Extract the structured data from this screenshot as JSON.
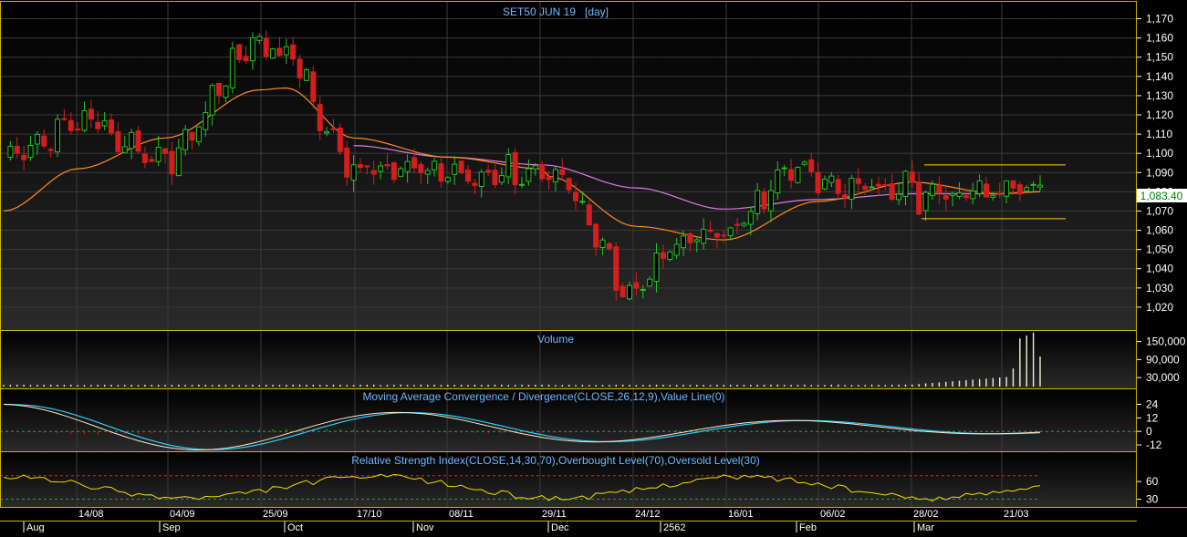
{
  "colors": {
    "background": "#000000",
    "panel_gradient_top": "#000000",
    "panel_gradient_bottom": "#2a2a2a",
    "frame": "#c8b400",
    "title": "#6fb7ff",
    "axis_text": "#ffffff",
    "grid": "#3a3a3a",
    "up_candle": "#22c422",
    "down_candle": "#d41e1e",
    "ma_fast": "#ff8a1e",
    "ma_slow": "#e07ae8",
    "range_lines": "#ffd200",
    "volume_bar": "#f4f0d8",
    "macd_line": "#ffe8c8",
    "macd_signal": "#2ad0ff",
    "macd_zero": "#3c9c3c",
    "rsi_line": "#f0e000",
    "rsi_overbought": "#c03030",
    "rsi_oversold": "#2aa02a",
    "last_price_bg": "#ffffff",
    "last_price_text": "#008000"
  },
  "price_panel": {
    "title": "SET50 JUN 19   [day]",
    "y_ticks": [
      "1,170",
      "1,160",
      "1,150",
      "1,140",
      "1,130",
      "1,120",
      "1,110",
      "1,100",
      "1,090",
      "1,080",
      "1,070",
      "1,060",
      "1,050",
      "1,040",
      "1,030",
      "1,020"
    ],
    "last_price_label": "1,083.40"
  },
  "volume_panel": {
    "title": "Volume",
    "y_ticks": [
      "150,000",
      "90,000",
      "30,000"
    ]
  },
  "macd_panel": {
    "title": "Moving Average Convergence / Divergence(CLOSE,26,12,9),Value Line(0)",
    "y_ticks": [
      "24",
      "12",
      "0",
      "-12"
    ]
  },
  "rsi_panel": {
    "title": "Relative Strength Index(CLOSE,14,30,70),Overbought Level(70),Oversold Level(30)",
    "y_ticks": [
      "60",
      "30"
    ]
  },
  "x_axis": {
    "date_labels": [
      "14/08",
      "04/09",
      "25/09",
      "17/10",
      "08/11",
      "29/11",
      "24/12",
      "16/01",
      "06/02",
      "28/02",
      "21/03"
    ],
    "period_labels": [
      "Aug",
      "Sep",
      "Oct",
      "Nov",
      "Dec",
      "2562",
      "Feb",
      "Mar"
    ]
  },
  "chart_data": [
    {
      "type": "candlestick",
      "title": "SET50 JUN 19   [day]",
      "ylim": [
        1010,
        1175
      ],
      "x": [
        "14/08",
        "04/09",
        "25/09",
        "17/10",
        "08/11",
        "29/11",
        "24/12",
        "16/01",
        "06/02",
        "28/02",
        "21/03"
      ],
      "close_anchors": [
        {
          "x": "start",
          "y": 1095
        },
        {
          "x": "14/08",
          "y": 1115
        },
        {
          "x": "Sep",
          "y": 1098
        },
        {
          "x": "25/09",
          "y": 1158
        },
        {
          "x": "Oct",
          "y": 1150
        },
        {
          "x": "17/10",
          "y": 1092
        },
        {
          "x": "Nov",
          "y": 1090
        },
        {
          "x": "08/11",
          "y": 1090
        },
        {
          "x": "29/11",
          "y": 1090
        },
        {
          "x": "Dec",
          "y": 1092
        },
        {
          "x": "24/12",
          "y": 1028
        },
        {
          "x": "2562",
          "y": 1050
        },
        {
          "x": "16/01",
          "y": 1058
        },
        {
          "x": "Feb",
          "y": 1092
        },
        {
          "x": "06/02",
          "y": 1085
        },
        {
          "x": "28/02",
          "y": 1082
        },
        {
          "x": "Mar",
          "y": 1078
        },
        {
          "x": "21/03",
          "y": 1080
        },
        {
          "x": "end",
          "y": 1083.4
        }
      ],
      "moving_average_fast_anchors": [
        {
          "x": "start",
          "y": 1070
        },
        {
          "x": "14/08",
          "y": 1092
        },
        {
          "x": "04/09",
          "y": 1108
        },
        {
          "x": "25/09",
          "y": 1133
        },
        {
          "x": "Oct",
          "y": 1134
        },
        {
          "x": "17/10",
          "y": 1108
        },
        {
          "x": "08/11",
          "y": 1098
        },
        {
          "x": "29/11",
          "y": 1092
        },
        {
          "x": "Dec",
          "y": 1088
        },
        {
          "x": "24/12",
          "y": 1062
        },
        {
          "x": "16/01",
          "y": 1055
        },
        {
          "x": "06/02",
          "y": 1075
        },
        {
          "x": "28/02",
          "y": 1085
        },
        {
          "x": "21/03",
          "y": 1079
        },
        {
          "x": "end",
          "y": 1080
        }
      ],
      "moving_average_slow_anchors": [
        {
          "x": "17/10",
          "y": 1104
        },
        {
          "x": "08/11",
          "y": 1098
        },
        {
          "x": "29/11",
          "y": 1094
        },
        {
          "x": "24/12",
          "y": 1082
        },
        {
          "x": "16/01",
          "y": 1071
        },
        {
          "x": "06/02",
          "y": 1076
        },
        {
          "x": "28/02",
          "y": 1079
        },
        {
          "x": "21/03",
          "y": 1079
        },
        {
          "x": "end",
          "y": 1080
        }
      ],
      "range_lines": [
        1094,
        1066
      ],
      "last_price": 1083.4
    },
    {
      "type": "bar",
      "title": "Volume",
      "ylim": [
        0,
        170000
      ],
      "y_ticks": [
        150000,
        90000,
        30000
      ],
      "notes_values": {
        "base_volume": 5000,
        "final_bars": [
          60000,
          160000,
          170000,
          180000,
          100000
        ]
      }
    },
    {
      "type": "line",
      "title": "Moving Average Convergence / Divergence(CLOSE,26,12,9),Value Line(0)",
      "ylim": [
        -16,
        26
      ],
      "zero_line": 0
    },
    {
      "type": "line",
      "title": "Relative Strength Index(CLOSE,14,30,70),Overbought Level(70),Oversold Level(30)",
      "ylim": [
        20,
        85
      ],
      "overbought": 70,
      "oversold": 30
    }
  ]
}
